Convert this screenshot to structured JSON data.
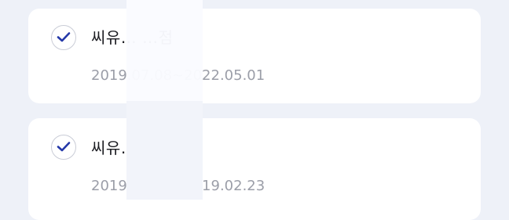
{
  "items": [
    {
      "checked": true,
      "title": "씨유… …점",
      "period": "2019.07.08~2022.05.01"
    },
    {
      "checked": true,
      "title": "씨유… …점",
      "period": "2019.01.01~2019.02.23"
    }
  ],
  "icons": {
    "checkbox": "check-icon"
  },
  "colors": {
    "background": "#eef1f8",
    "card": "#ffffff",
    "check": "#2438a8",
    "title": "#1b1c21",
    "period": "#9b9ea8"
  }
}
